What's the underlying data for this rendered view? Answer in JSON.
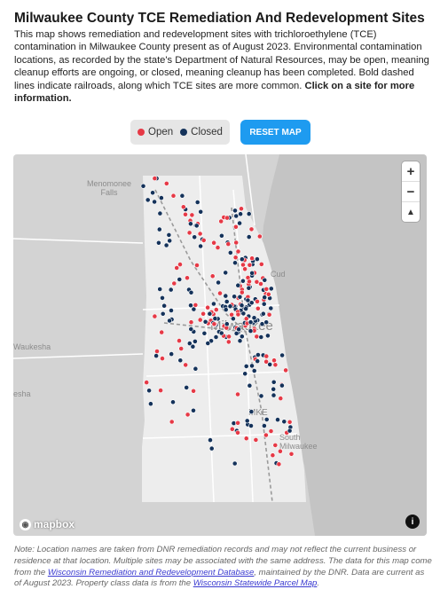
{
  "header": {
    "title": "Milwaukee County TCE Remediation And Redevelopment Sites",
    "intro": "This map shows remediation and redevelopment sites with trichloroethylene (TCE) contamination in Milwaukee County present as of August 2023. Environmental contamination locations, as recorded by the state's Department of Natural Resources, may be open, meaning cleanup efforts are ongoing, or closed, meaning cleanup has been completed. Bold dashed lines indicate railroads, along which TCE sites are more common.",
    "intro_bold": "Click on a site for more information."
  },
  "legend": {
    "open_label": "Open",
    "closed_label": "Closed",
    "open_color": "#e63946",
    "closed_color": "#14325a"
  },
  "reset_button": "RESET MAP",
  "map": {
    "place_labels": [
      "Menomonee Falls",
      "Waukesha",
      "esha",
      "Milwaukee",
      "MKE",
      "South Milwaukee",
      "Cud"
    ],
    "zoom_in": "+",
    "zoom_out": "−",
    "compass": "▲",
    "attribution": "mapbox",
    "info": "i"
  },
  "footer": {
    "note_start": "Note: Location names are taken from DNR remediation records and may not reflect the current business or residence at that location. Multiple sites may be associated with the same address. The data for this map come from the ",
    "link1": "Wisconsin Remediation and Redevelopment Database",
    "note_mid": ", maintained by the DNR. Data are current as of August 2023. Property class data is from the ",
    "link2": "Wisconsin Statewide Parcel Map",
    "note_end": "."
  }
}
